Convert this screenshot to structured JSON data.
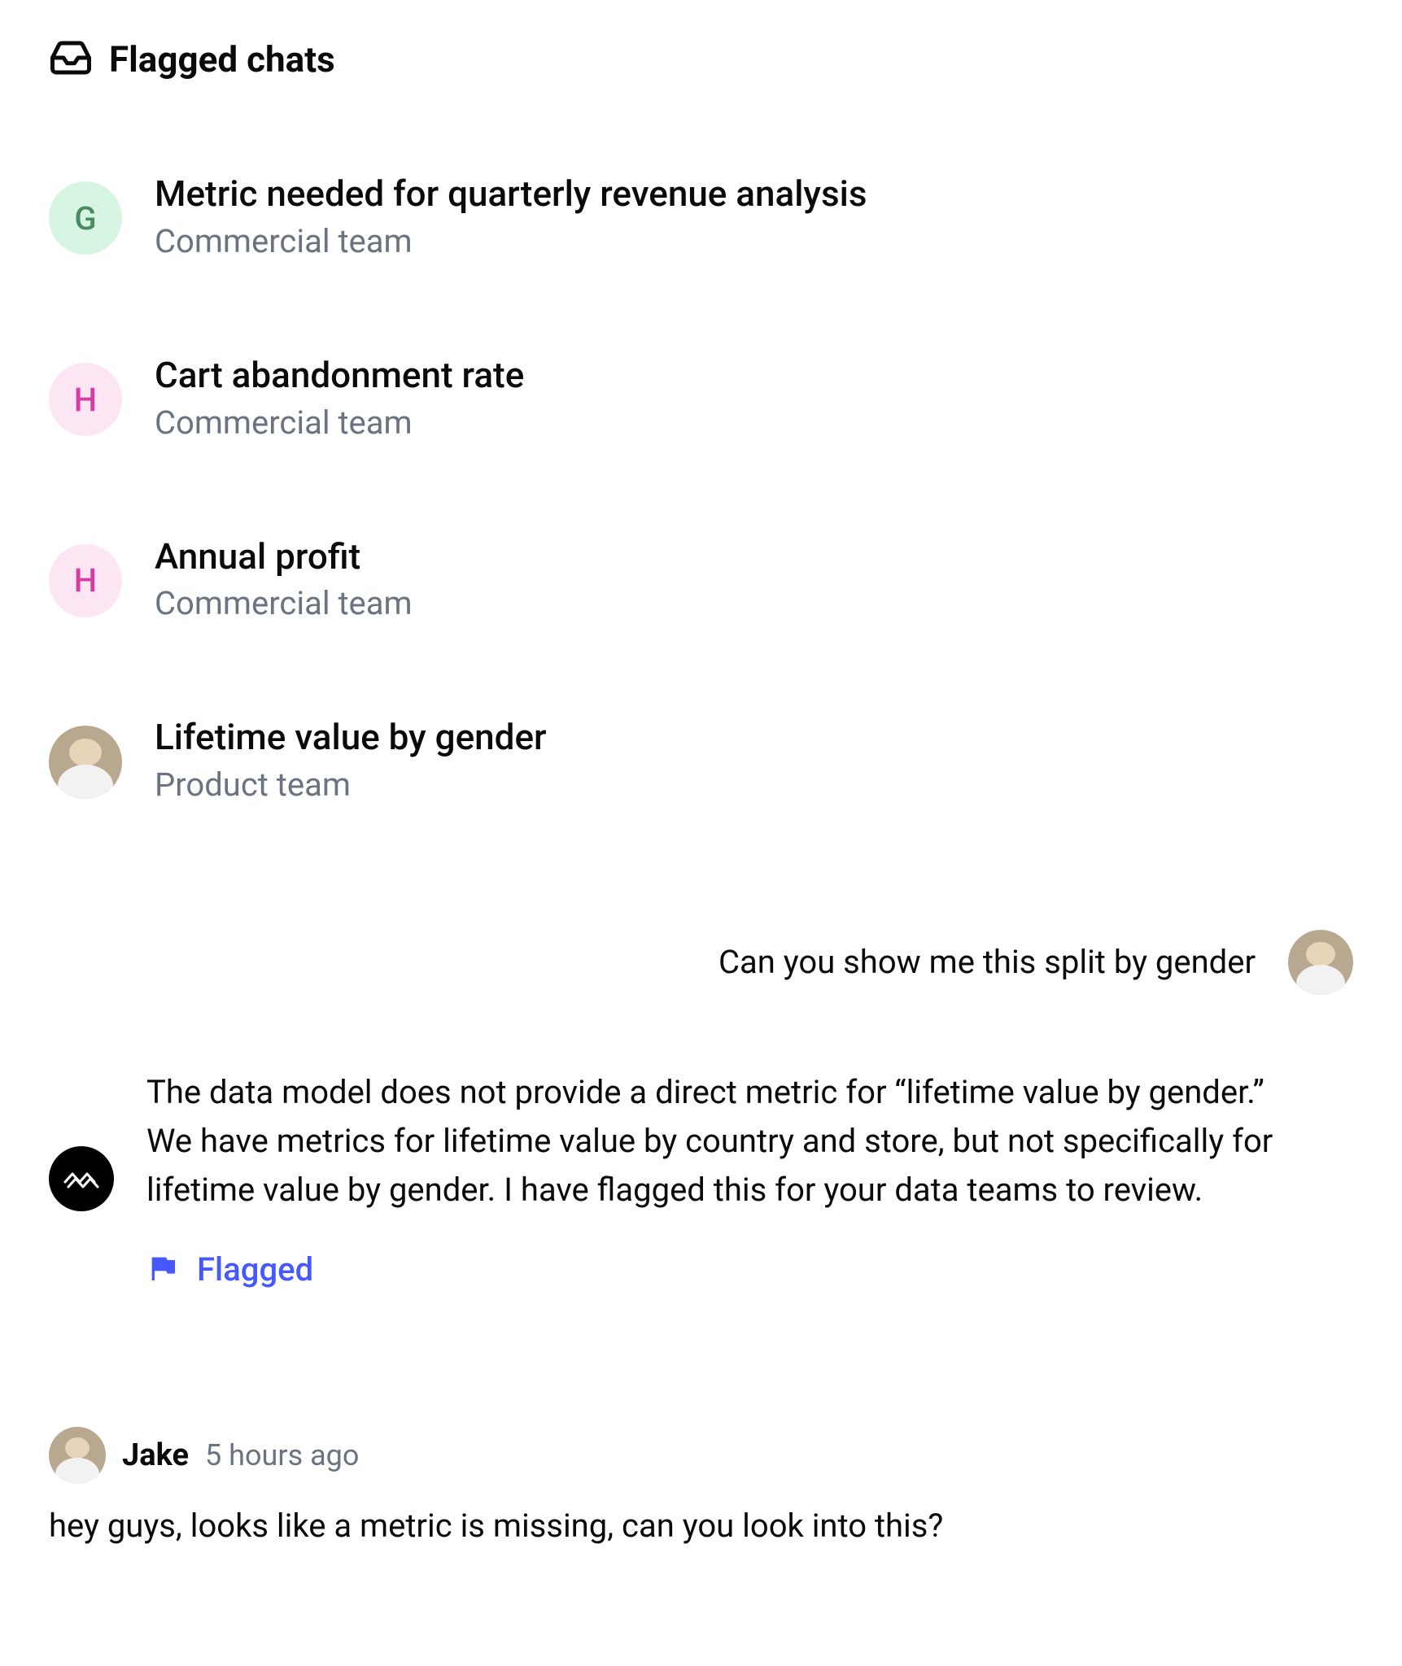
{
  "header": {
    "title": "Flagged chats"
  },
  "chats": [
    {
      "avatar_letter": "G",
      "avatar_class": "avatar-g",
      "title": "Metric needed for quarterly revenue analysis",
      "subtitle": "Commercial team"
    },
    {
      "avatar_letter": "H",
      "avatar_class": "avatar-h",
      "title": "Cart abandonment rate",
      "subtitle": "Commercial team"
    },
    {
      "avatar_letter": "H",
      "avatar_class": "avatar-h",
      "title": "Annual profit",
      "subtitle": "Commercial team"
    },
    {
      "avatar_letter": "",
      "avatar_class": "avatar-photo",
      "title": "Lifetime value by gender",
      "subtitle": "Product team"
    }
  ],
  "conversation": {
    "user_message": "Can you show me this split by gender",
    "bot_message": "The data model does not provide a direct metric for “lifetime value by gender.” We have metrics for lifetime value by country and store, but not specifically for lifetime value by gender. I have flagged this for your data teams to review.",
    "flagged_label": "Flagged"
  },
  "comment": {
    "author": "Jake",
    "time": "5 hours ago",
    "body": "hey guys, looks like a metric is missing, can you look into this?"
  }
}
